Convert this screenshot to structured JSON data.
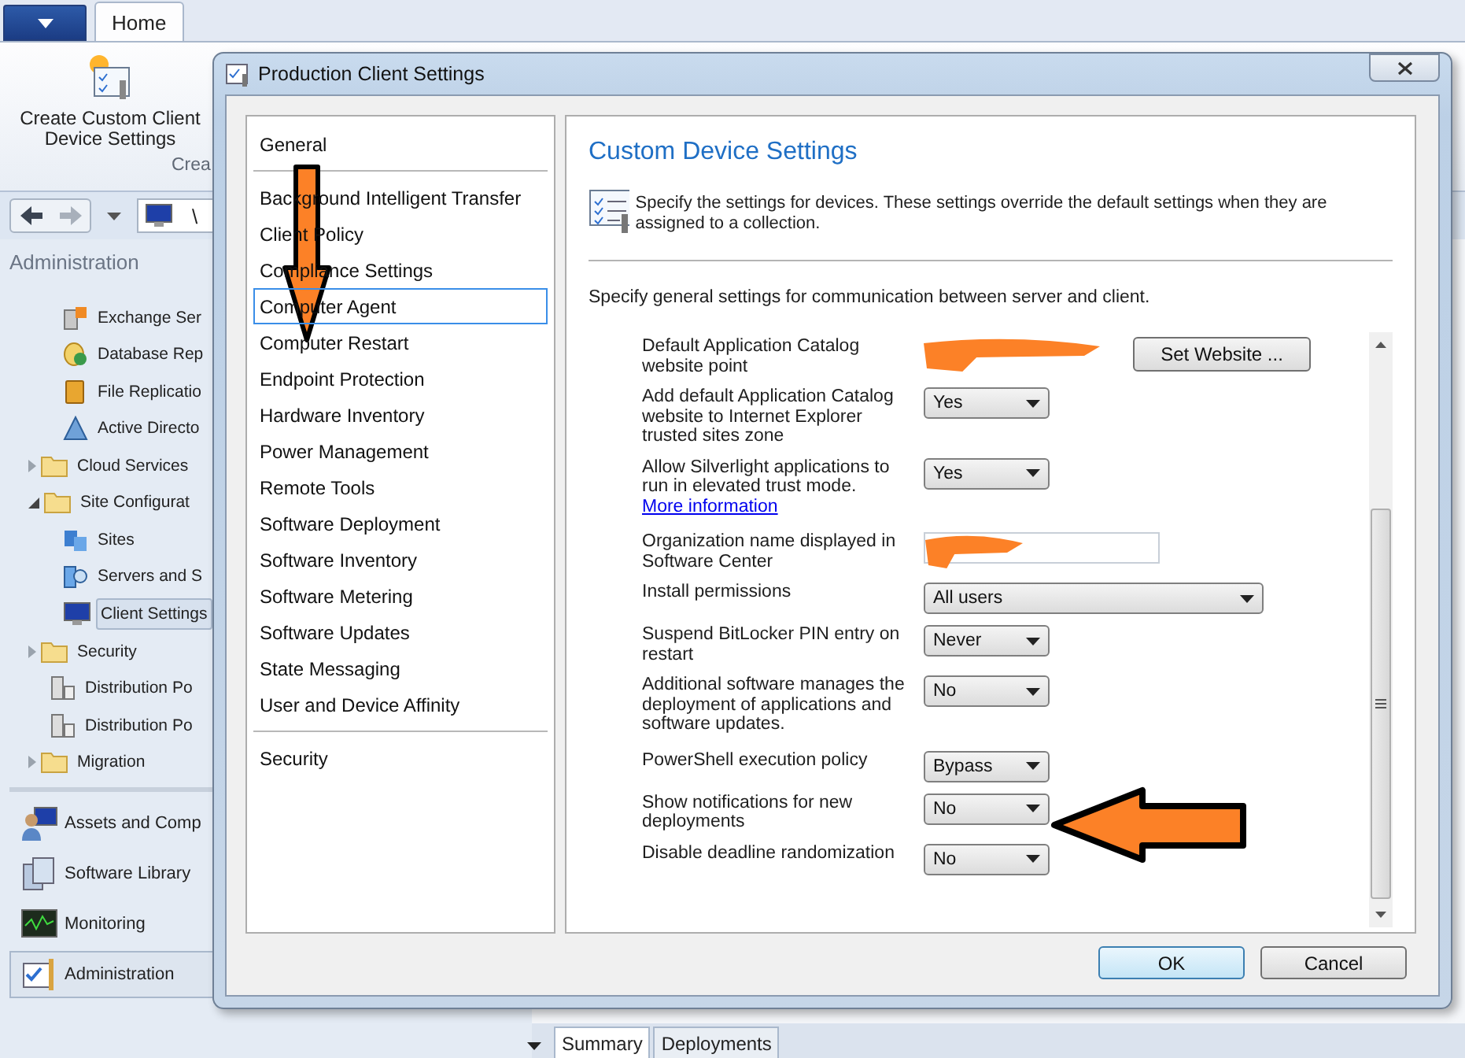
{
  "app": {
    "menu_tab": "Home",
    "ribbon_button": "Create Custom Client Device Settings",
    "ribbon_group": "Crea",
    "address": "\\",
    "pane_title": "Administration",
    "tree": {
      "continued": [
        {
          "label": "Exchange Ser"
        },
        {
          "label": "Database Rep"
        },
        {
          "label": "File Replicatio"
        },
        {
          "label": "Active Directo"
        }
      ],
      "items": [
        {
          "label": "Cloud Services",
          "expanded": false,
          "selected": false
        },
        {
          "label": "Site Configurat",
          "expanded": true,
          "selected": false,
          "children": [
            {
              "label": "Sites",
              "selected": false
            },
            {
              "label": "Servers and S",
              "selected": false
            },
            {
              "label": "Client Settings",
              "selected": true
            }
          ]
        },
        {
          "label": "Security",
          "expanded": false,
          "selected": false
        },
        {
          "label": "Distribution Po",
          "kind": "leaf",
          "selected": false
        },
        {
          "label": "Distribution Po",
          "kind": "leaf",
          "selected": false
        },
        {
          "label": "Migration",
          "expanded": false,
          "selected": false
        }
      ]
    },
    "workspaces": [
      {
        "label": "Assets and Comp",
        "selected": false
      },
      {
        "label": "Software Library",
        "selected": false
      },
      {
        "label": "Monitoring",
        "selected": false
      },
      {
        "label": "Administration",
        "selected": true
      }
    ],
    "bottom_tabs": [
      {
        "label": "Summary",
        "selected": true
      },
      {
        "label": "Deployments",
        "selected": false
      }
    ]
  },
  "dialog": {
    "title": "Production Client Settings",
    "nav": [
      [
        {
          "label": "General",
          "selected": false
        }
      ],
      [
        {
          "label": "Background Intelligent Transfer",
          "selected": false
        },
        {
          "label": "Client Policy",
          "selected": false
        },
        {
          "label": "Compliance Settings",
          "selected": false
        },
        {
          "label": "Computer Agent",
          "selected": true
        },
        {
          "label": "Computer Restart",
          "selected": false
        },
        {
          "label": "Endpoint Protection",
          "selected": false
        },
        {
          "label": "Hardware Inventory",
          "selected": false
        },
        {
          "label": "Power Management",
          "selected": false
        },
        {
          "label": "Remote Tools",
          "selected": false
        },
        {
          "label": "Software Deployment",
          "selected": false
        },
        {
          "label": "Software Inventory",
          "selected": false
        },
        {
          "label": "Software Metering",
          "selected": false
        },
        {
          "label": "Software Updates",
          "selected": false
        },
        {
          "label": "State Messaging",
          "selected": false
        },
        {
          "label": "User and Device Affinity",
          "selected": false
        }
      ],
      [
        {
          "label": "Security",
          "selected": false
        }
      ]
    ],
    "heading": "Custom Device Settings",
    "description": "Specify the settings for devices. These settings override the default settings when they are assigned to a collection.",
    "section_intro": "Specify general settings for communication between server and client.",
    "settings": [
      {
        "kind": "button",
        "label": "Default Application Catalog website point",
        "redacted": true,
        "button": "Set Website ..."
      },
      {
        "kind": "select",
        "label": "Add default Application Catalog website to Internet Explorer trusted sites zone",
        "value": "Yes"
      },
      {
        "kind": "select",
        "label": "Allow Silverlight applications to run in elevated trust mode.",
        "link": "More information",
        "value": "Yes"
      },
      {
        "kind": "text",
        "label": "Organization name displayed in Software Center",
        "redacted": true
      },
      {
        "kind": "select",
        "label": "Install permissions",
        "value": "All users",
        "wide": true
      },
      {
        "kind": "select",
        "label": "Suspend BitLocker PIN entry on restart",
        "value": "Never"
      },
      {
        "kind": "select",
        "label": "Additional software manages the deployment of applications and software updates.",
        "value": "No"
      },
      {
        "kind": "select",
        "label": "PowerShell execution policy",
        "value": "Bypass"
      },
      {
        "kind": "select",
        "label": "Show notifications for new deployments",
        "value": "No",
        "pointer": true
      },
      {
        "kind": "select",
        "label": "Disable deadline randomization",
        "value": "No"
      }
    ],
    "buttons": [
      {
        "label": "OK",
        "default": true
      },
      {
        "label": "Cancel",
        "default": false
      }
    ]
  }
}
